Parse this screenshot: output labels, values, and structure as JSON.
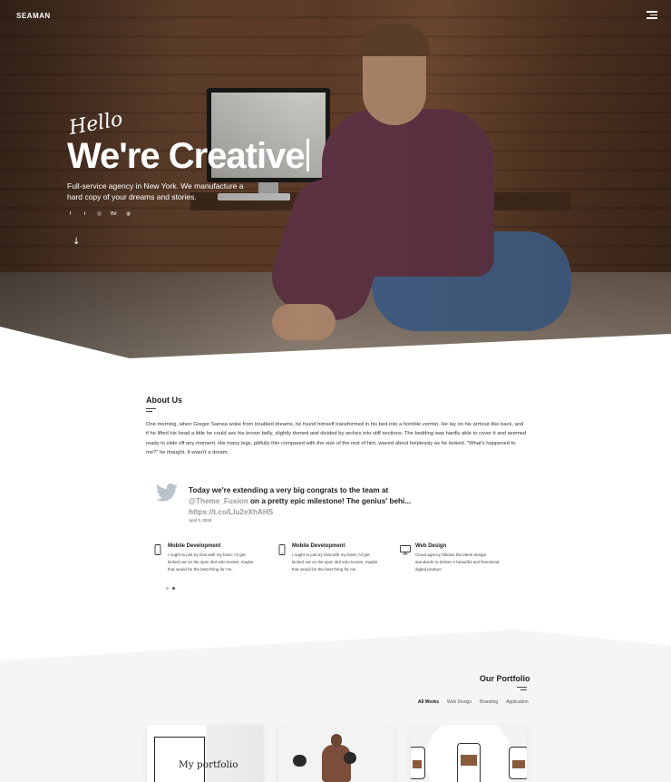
{
  "header": {
    "brand": "SEAMAN",
    "menu_icon": "hamburger-icon"
  },
  "hero": {
    "script_text": "Hello",
    "headline": "We're Creative",
    "tagline": "Full-service agency in New York. We manufacture a hard copy of your dreams and stories.",
    "socials": [
      {
        "icon": "facebook-icon",
        "glyph": "f"
      },
      {
        "icon": "twitter-icon",
        "glyph": "t"
      },
      {
        "icon": "instagram-icon",
        "glyph": "◎"
      },
      {
        "icon": "behance-icon",
        "glyph": "Bē"
      },
      {
        "icon": "dribbble-icon",
        "glyph": "◍"
      }
    ],
    "scroll_icon": "arrow-down-icon",
    "scroll_glyph": "↓"
  },
  "about": {
    "title": "About Us",
    "text": "One morning, when Gregor Samsa woke from troubled dreams, he found himself transformed in his bed into a horrible vermin. He lay on his armour-like back, and if he lifted his head a little he could see his brown belly, slightly domed and divided by arches into stiff sections. The bedding was hardly able to cover it and seemed ready to slide off any moment. His many legs, pitifully thin compared with the size of the rest of him, waved about helplessly as he looked. \"What's happened to me?\" he thought. It wasn't a dream."
  },
  "tweet": {
    "text_before": "Today we're extending a very big congrats to the team at ",
    "handle": "@Theme_Fusion",
    "text_after": " on a pretty epic milestone! The genius' behi...",
    "link": "https://t.co/Llu2eXhAHS",
    "date": "April 3, 2019"
  },
  "services": [
    {
      "icon": "mobile-icon",
      "title": "Mobile Development",
      "desc": "I ought to just try that with my boss; I'd get kicked out on the spot. But who knows, maybe that would be the best thing for me."
    },
    {
      "icon": "mobile-icon",
      "title": "Mobile Development",
      "desc": "I ought to just try that with my boss; I'd get kicked out on the spot. But who knows, maybe that would be the best thing for me."
    },
    {
      "icon": "monitor-icon",
      "title": "Web Design",
      "desc": "Cloud agency follows the latest design standards to deliver a beautiful and functional digital product."
    }
  ],
  "portfolio": {
    "title": "Our Portfolio",
    "filters": [
      "All Works",
      "Web Design",
      "Branding",
      "Application"
    ],
    "active_filter": "All Works",
    "cards": [
      {
        "caption": "My portfolio"
      }
    ]
  }
}
